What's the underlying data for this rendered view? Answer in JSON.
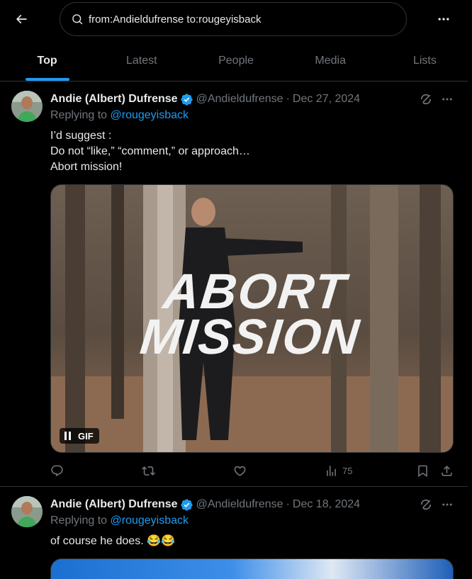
{
  "header": {
    "back_icon": "arrow-left-icon",
    "search": {
      "value": "from:Andieldufrense to:rougeyisback",
      "icon": "search-icon"
    },
    "more_icon": "more-horizontal-icon"
  },
  "tabs": [
    {
      "label": "Top",
      "active": true
    },
    {
      "label": "Latest",
      "active": false
    },
    {
      "label": "People",
      "active": false
    },
    {
      "label": "Media",
      "active": false
    },
    {
      "label": "Lists",
      "active": false
    }
  ],
  "colors": {
    "accent": "#1d9bf0",
    "muted": "#71767b",
    "text": "#e7e9ea",
    "border": "#2f3336",
    "background": "#000000"
  },
  "tweets": [
    {
      "display_name": "Andie (Albert) Dufrense",
      "verified": true,
      "handle": "@Andieldufrense",
      "separator": "·",
      "date": "Dec 27, 2024",
      "replying_label": "Replying to",
      "replying_to": "@rougeyisback",
      "text_lines": [
        "I’d suggest :",
        "Do not “like,” “comment,” or approach…",
        "Abort mission!"
      ],
      "media": {
        "type": "gif",
        "overlay_lines": [
          "ABORT",
          "MISSION"
        ],
        "badge": "GIF",
        "badge_icon": "pause-icon"
      },
      "actions": {
        "reply": "",
        "repost": "",
        "like": "",
        "views": "75"
      }
    },
    {
      "display_name": "Andie (Albert) Dufrense",
      "verified": true,
      "handle": "@Andieldufrense",
      "separator": "·",
      "date": "Dec 18, 2024",
      "replying_label": "Replying to",
      "replying_to": "@rougeyisback",
      "text": "of course he does. 😂😂"
    }
  ]
}
